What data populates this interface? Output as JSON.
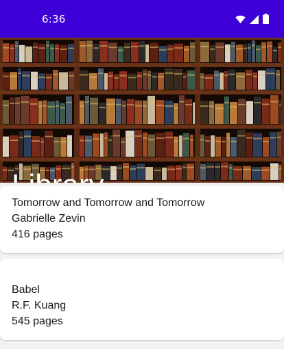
{
  "status_bar": {
    "time": "6:36",
    "icons": [
      "wifi-icon",
      "signal-icon",
      "battery-icon"
    ],
    "color": "#3d00d6"
  },
  "header": {
    "title": "Library",
    "image": "bookshelf-image"
  },
  "books": [
    {
      "title": "Tomorrow and Tomorrow and Tomorrow",
      "author": "Gabrielle Zevin",
      "pages": "416 pages"
    },
    {
      "title": "Babel",
      "author": "R.F. Kuang",
      "pages": "545 pages"
    }
  ]
}
